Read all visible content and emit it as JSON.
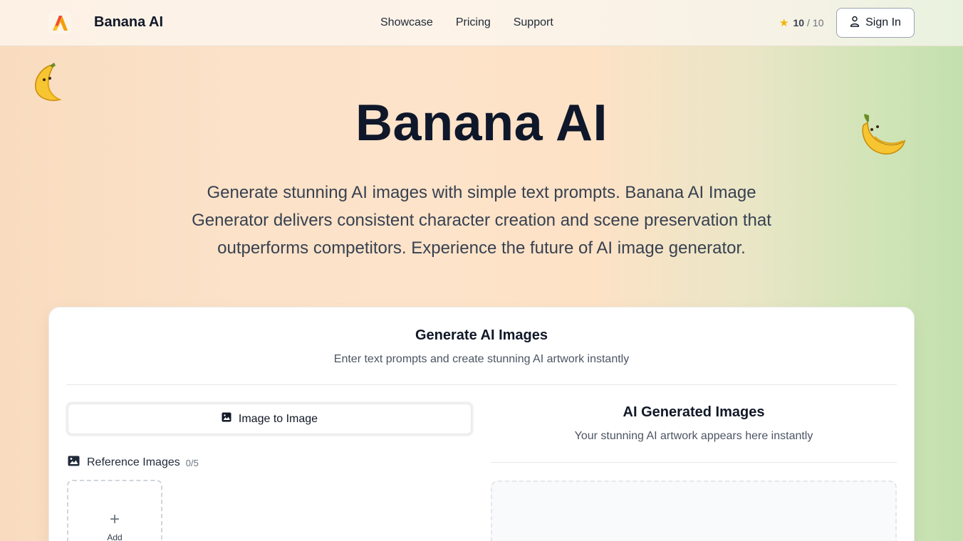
{
  "header": {
    "brand": "Banana AI",
    "nav": [
      "Showcase",
      "Pricing",
      "Support"
    ],
    "rating_value": "10",
    "rating_sep": "/",
    "rating_max": "10",
    "signin_label": "Sign In",
    "accent_color": "#f5b301"
  },
  "hero": {
    "title": "Banana AI",
    "subtitle": "Generate stunning AI images with simple text prompts. Banana AI Image Generator delivers consistent character creation and scene preservation that outperforms competitors. Experience the future of AI image generator."
  },
  "generator": {
    "title": "Generate AI Images",
    "subtitle": "Enter text prompts and create stunning AI artwork instantly",
    "mode_tab": "Image to Image",
    "reference_label": "Reference Images",
    "reference_count": "0/5",
    "add_label": "Add",
    "output_title": "AI Generated Images",
    "output_subtitle": "Your stunning AI artwork appears here instantly"
  },
  "icons": {
    "logo": "banana-ai-logo-icon",
    "star": "star-icon",
    "user": "user-icon",
    "image": "image-icon",
    "plus": "plus-icon",
    "banana": "banana-icon"
  }
}
